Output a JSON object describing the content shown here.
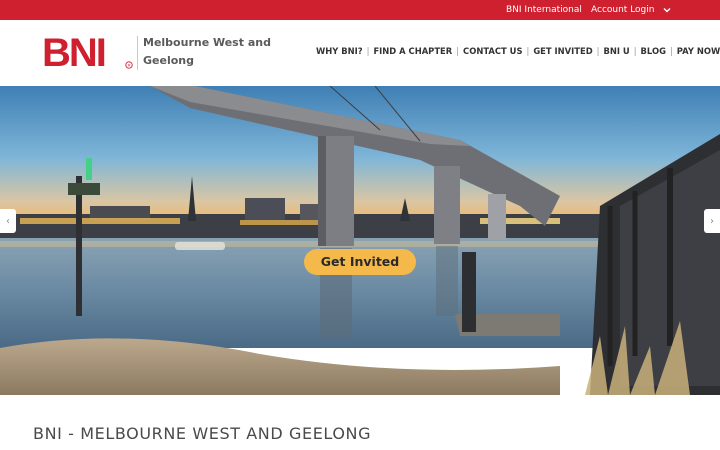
{
  "topbar": {
    "international_label": "BNI International",
    "account_label": "Account Login",
    "bg_color": "#cf2030"
  },
  "header": {
    "logo_text": "BNI",
    "chapter_name": "Melbourne West and Geelong",
    "nav": [
      {
        "label": "WHY BNI?"
      },
      {
        "label": "FIND A CHAPTER"
      },
      {
        "label": "CONTACT US"
      },
      {
        "label": "GET INVITED"
      },
      {
        "label": "BNI U"
      },
      {
        "label": "BLOG"
      },
      {
        "label": "PAY NOW"
      }
    ]
  },
  "hero": {
    "cta_label": "Get Invited",
    "cta_color": "#f4b94a",
    "slides_total": 3,
    "active_slide": 1,
    "prev_icon": "chevron-left-icon",
    "next_icon": "chevron-right-icon"
  },
  "page": {
    "heading": "BNI - MELBOURNE WEST AND GEELONG"
  }
}
